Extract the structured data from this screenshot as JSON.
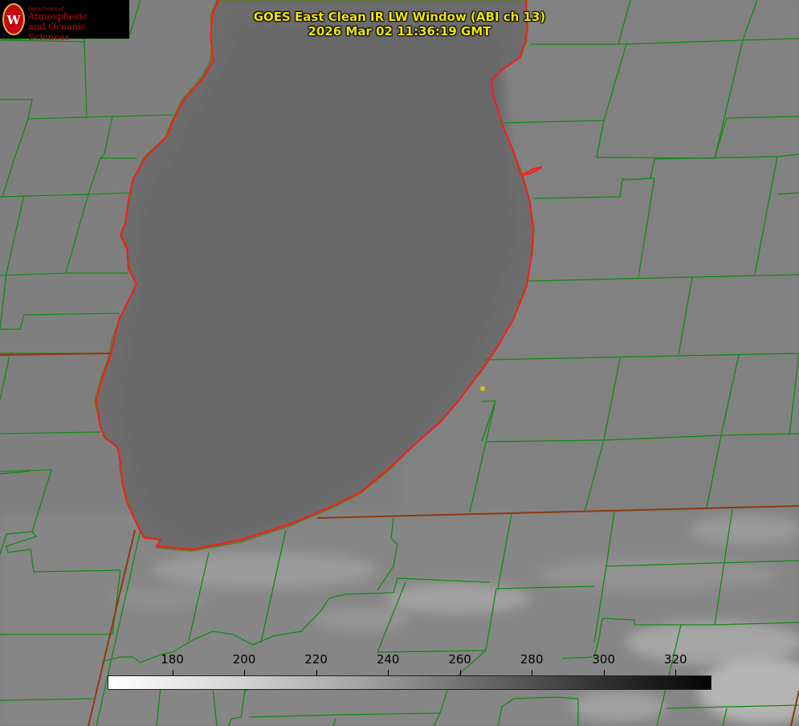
{
  "title": {
    "line1": "GOES East Clean IR LW Window (ABI ch 13)",
    "line2": "2026 Mar 02 11:36:19 GMT"
  },
  "logo": {
    "seal_letter": "W",
    "department": "Department of",
    "name_line1": "Atmospheric",
    "name_line2": "and Oceanic Sciences",
    "icon": "uw-crest-icon"
  },
  "colorbar": {
    "ticks": [
      "180",
      "200",
      "220",
      "240",
      "260",
      "280",
      "300",
      "320"
    ],
    "range": [
      162,
      330
    ],
    "colors": {
      "low": "#ffffff",
      "high": "#000000"
    }
  },
  "colors": {
    "land": "#7e7e7e",
    "lake": "#6b6b6b",
    "county_lines": "#138a13",
    "state_lines": "#8b3a10",
    "coastline": "#ff1a1a",
    "title_text": "#f2e600",
    "marker": "#d4c400"
  }
}
